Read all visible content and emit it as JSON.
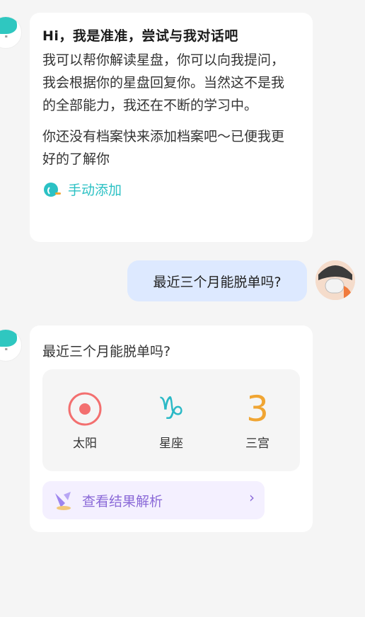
{
  "bot_greeting": {
    "title": "Hi，我是准准，尝试与我对话吧",
    "paragraph1": "我可以帮你解读星盘，你可以向我提问，我会根据你的星盘回复你。当然这不是我的全部能力，我还在不断的学习中。",
    "paragraph2": "你还没有档案快来添加档案吧～已便我更好的了解你",
    "add_label": "手动添加"
  },
  "user_message": {
    "text": "最近三个月能脱单吗?"
  },
  "bot_answer": {
    "question": "最近三个月能脱单吗?",
    "stats": [
      {
        "glyph": "sun-icon",
        "label": "太阳",
        "color": "#f36f6f"
      },
      {
        "glyph": "♑",
        "label": "星座",
        "color": "#2bb9c6"
      },
      {
        "glyph": "3",
        "label": "三宫",
        "color": "#f0a533"
      }
    ],
    "result_label": "查看结果解析",
    "result_chevron": "›"
  }
}
